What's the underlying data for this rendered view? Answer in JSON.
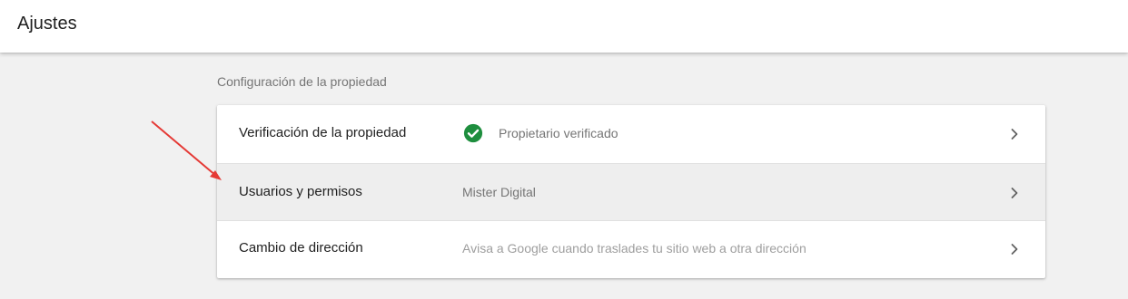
{
  "header": {
    "title": "Ajustes"
  },
  "section": {
    "title": "Configuración de la propiedad"
  },
  "rows": [
    {
      "label": "Verificación de la propiedad",
      "value": "Propietario verificado",
      "icon": "check-circle-icon",
      "icon_color": "#1e8e3e"
    },
    {
      "label": "Usuarios y permisos",
      "value": "Mister Digital",
      "highlighted": true
    },
    {
      "label": "Cambio de dirección",
      "value": "Avisa a Google cuando traslades tu sitio web a otra dirección"
    }
  ],
  "colors": {
    "annotation_arrow": "#e53935",
    "check": "#1e8e3e",
    "row_highlight": "#eeeeee"
  }
}
